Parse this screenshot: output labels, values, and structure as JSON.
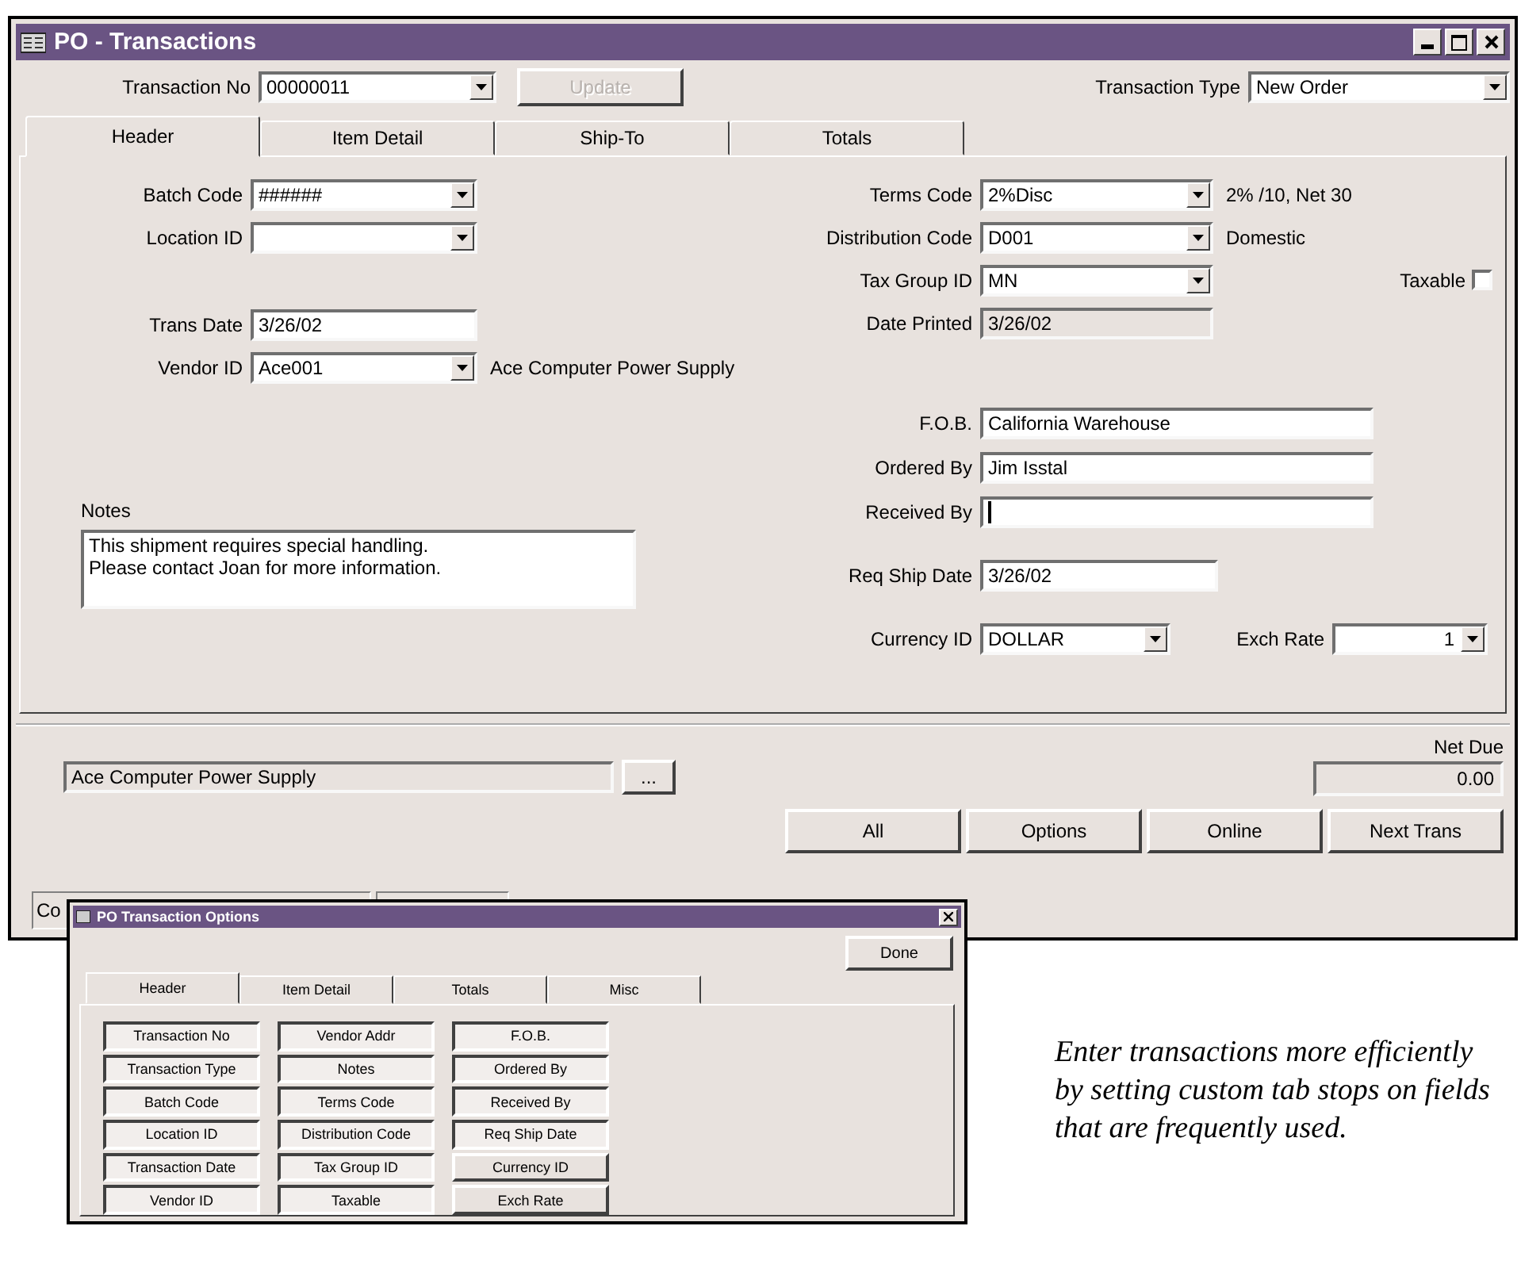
{
  "window": {
    "title": "PO - Transactions"
  },
  "top": {
    "transaction_no": {
      "label": "Transaction No",
      "value": "00000011"
    },
    "update_button": {
      "label": "Update",
      "disabled": true
    },
    "transaction_type": {
      "label": "Transaction Type",
      "value": "New Order"
    }
  },
  "tabs": [
    {
      "label": "Header",
      "selected": true
    },
    {
      "label": "Item Detail",
      "selected": false
    },
    {
      "label": "Ship-To",
      "selected": false
    },
    {
      "label": "Totals",
      "selected": false
    }
  ],
  "left_fields": [
    {
      "label": "Batch Code",
      "value": "######",
      "kind": "combo"
    },
    {
      "label": "Location ID",
      "kind": "combo"
    },
    {
      "label": "Trans Date",
      "value": "3/26/02",
      "kind": "text"
    },
    {
      "label": "Vendor ID",
      "value": "Ace001",
      "kind": "combo",
      "description": "Ace Computer Power Supply"
    }
  ],
  "right_fields": [
    {
      "label": "Terms Code",
      "value": "2%Disc",
      "kind": "combo",
      "description": "2% /10, Net 30"
    },
    {
      "label": "Distribution Code",
      "value": "D001",
      "kind": "combo",
      "description": "Domestic"
    },
    {
      "label": "Tax Group ID",
      "value": "MN",
      "kind": "combo"
    },
    {
      "label": "Date Printed",
      "value": "3/26/02",
      "kind": "readonly"
    }
  ],
  "taxable": {
    "label": "Taxable",
    "checked": false
  },
  "ship_fields": [
    {
      "label": "F.O.B.",
      "value": "California Warehouse",
      "focused": false
    },
    {
      "label": "Ordered By",
      "value": "Jim Isstal",
      "focused": false
    },
    {
      "label": "Received By",
      "focused": true
    }
  ],
  "req_ship_date": {
    "label": "Req Ship Date",
    "value": "3/26/02"
  },
  "currency": {
    "label": "Currency ID",
    "value": "DOLLAR"
  },
  "exch_rate": {
    "label": "Exch Rate",
    "value": "1"
  },
  "notes": {
    "label": "Notes",
    "lines": [
      "This shipment requires special handling.",
      "Please contact Joan for more information."
    ]
  },
  "vendor_name": "Ace Computer Power Supply",
  "browse_button": "...",
  "net_due": {
    "label": "Net Due",
    "value": "0.00"
  },
  "buttons": [
    "All",
    "Options",
    "Online",
    "Next Trans"
  ],
  "status_bar": "Co",
  "options_dialog": {
    "title": "PO Transaction Options",
    "done_button": "Done",
    "tabs": [
      {
        "label": "Header",
        "selected": true
      },
      {
        "label": "Item Detail",
        "selected": false
      },
      {
        "label": "Totals",
        "selected": false
      },
      {
        "label": "Misc",
        "selected": false
      }
    ],
    "columns": [
      [
        {
          "label": "Transaction No",
          "on": true
        },
        {
          "label": "Transaction Type",
          "on": true
        },
        {
          "label": "Batch Code",
          "on": true
        },
        {
          "label": "Location ID",
          "on": true
        },
        {
          "label": "Transaction Date",
          "on": true
        },
        {
          "label": "Vendor ID",
          "on": true
        }
      ],
      [
        {
          "label": "Vendor Addr",
          "on": true
        },
        {
          "label": "Notes",
          "on": true
        },
        {
          "label": "Terms Code",
          "on": true
        },
        {
          "label": "Distribution Code",
          "on": true
        },
        {
          "label": "Tax Group ID",
          "on": true
        },
        {
          "label": "Taxable",
          "on": true
        }
      ],
      [
        {
          "label": "F.O.B.",
          "on": true
        },
        {
          "label": "Ordered By",
          "on": true
        },
        {
          "label": "Received By",
          "on": true
        },
        {
          "label": "Req Ship Date",
          "on": true
        },
        {
          "label": "Currency ID",
          "on": false
        },
        {
          "label": "Exch Rate",
          "on": false
        }
      ]
    ]
  },
  "caption": "Enter transactions more efficiently by setting custom tab stops on fields that are frequently used."
}
